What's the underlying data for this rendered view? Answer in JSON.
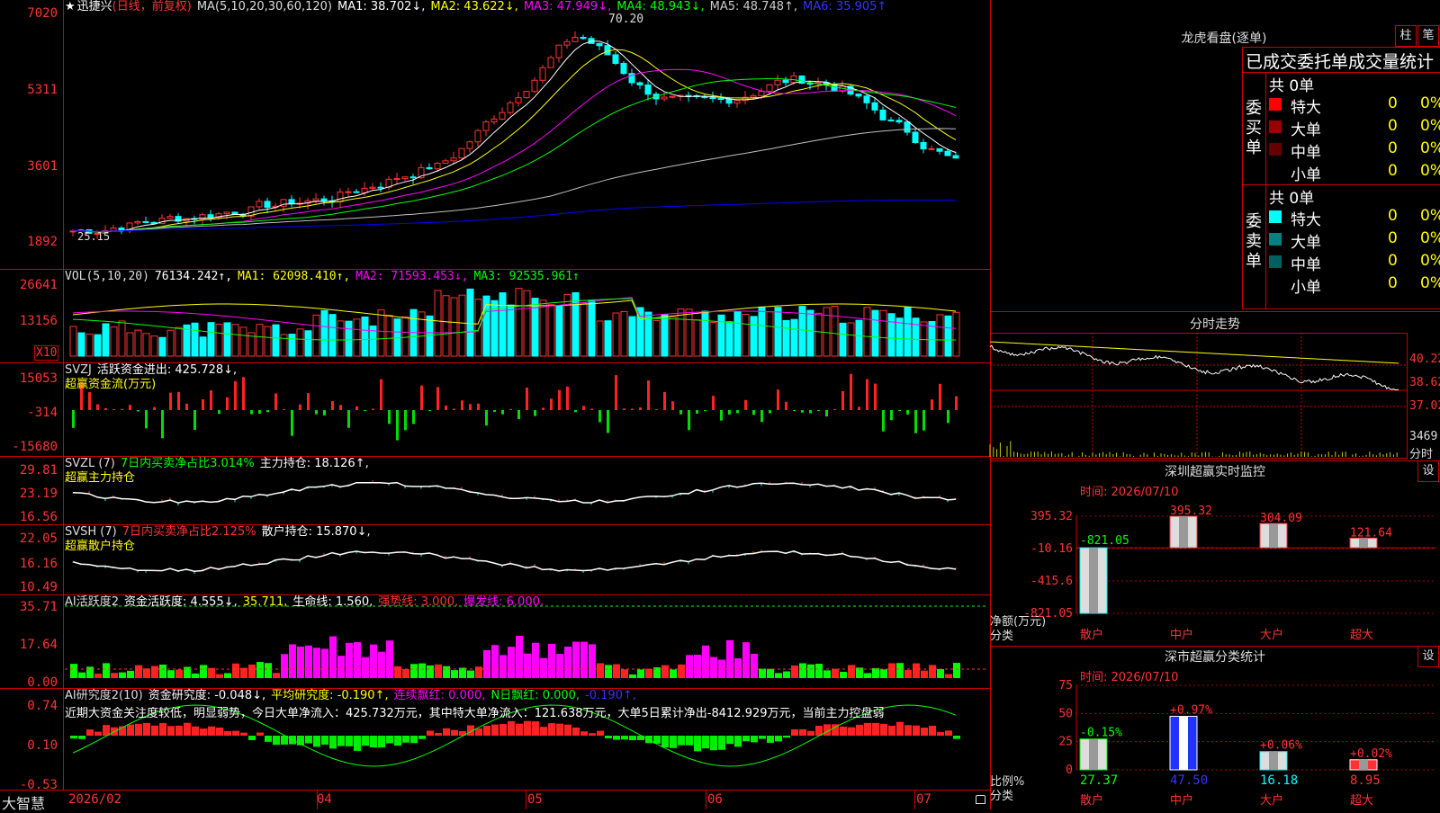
{
  "kline": {
    "title_star": "★",
    "stock": "迅捷兴",
    "mode": "(日线，前复权)",
    "ma_label": "MA(5,10,20,30,60,120)",
    "ma1": "MA1: 38.702↓,",
    "ma2": "MA2: 43.622↓,",
    "ma3": "MA3: 47.949↓,",
    "ma4": "MA4: 48.943↓,",
    "ma5": "MA5: 48.748↑,",
    "ma6": "MA6: 35.905↑",
    "peak_label": "70.20",
    "low_label": "25.15",
    "y_labels": [
      "7020",
      "5311",
      "3601",
      "1892"
    ],
    "colors": {
      "ma1": "#ffffff",
      "ma2": "#ffff00",
      "ma3": "#ff00ff",
      "ma4": "#00ff00",
      "ma5": "#c0c0c0",
      "ma6": "#0000ff"
    }
  },
  "vol": {
    "label": "VOL(5,10,20)",
    "value": "76134.242↑,",
    "ma1": "MA1: 62098.410↑,",
    "ma2": "MA2: 71593.453↓,",
    "ma3": "MA3: 92535.961↑",
    "y_labels": [
      "26641",
      "13156"
    ],
    "unit": "X10"
  },
  "svzj": {
    "label": "SVZJ",
    "name": "活跃资金进出: 425.728↓,",
    "sub": "超赢资金流(万元)",
    "y_labels": [
      "15053",
      "-314",
      "-15680"
    ]
  },
  "svzl": {
    "label": "SVZL (7)",
    "pct": "7日内买卖净占比3.014%",
    "hold": "主力持仓: 18.126↑,",
    "sub": "超赢主力持仓",
    "y_labels": [
      "29.81",
      "23.19",
      "16.56"
    ]
  },
  "svsh": {
    "label": "SVSH (7)",
    "pct": "7日内买卖净占比2.125%",
    "hold": "散户持仓: 15.870↓,",
    "sub": "超赢散户持仓",
    "y_labels": [
      "22.05",
      "16.16",
      "10.49"
    ]
  },
  "ai1": {
    "label": "AI活跃度2",
    "name": "资金活跃度: 4.555↓,",
    "v2": "35.711,",
    "life": "生命线: 1.560,",
    "strong": "强势线: 3.000,",
    "burst": "爆发线: 6.000,",
    "y_labels": [
      "35.71",
      "17.64",
      "0.00"
    ]
  },
  "ai2": {
    "label": "AI研究度2(10)",
    "name": "资金研究度: -0.048↓,",
    "avg": "平均研究度: -0.190↑,",
    "red": "连续飘红: 0.000,",
    "nred": "N日飘红: 0.000,",
    "last": "-0.190↑,",
    "comment": "近期大资金关注度较低，明显弱势，今日大单净流入：425.732万元，其中特大单净流入：121.638万元，大单5日累计净出-8412.929万元，当前主力控盘弱",
    "y_labels": [
      "0.74",
      "0.10",
      "-0.53"
    ]
  },
  "xaxis": {
    "brand": "大智慧",
    "labels": [
      "2026/02",
      "04",
      "05",
      "06",
      "07"
    ]
  },
  "dragon": {
    "title": "龙虎看盘(逐单)",
    "btn1": "柱",
    "btn2": "笔",
    "tabs": "已成交委托单成交量统计",
    "buy_label": "委买单",
    "sell_label": "委卖单",
    "buy_total": "共 0单",
    "sell_total": "共 0单",
    "buy_rows": [
      {
        "name": "特大",
        "count": "0",
        "pct": "0%",
        "color": "#ff0000"
      },
      {
        "name": "大单",
        "count": "0",
        "pct": "0%",
        "color": "#990000"
      },
      {
        "name": "中单",
        "count": "0",
        "pct": "0%",
        "color": "#660000"
      },
      {
        "name": "小单",
        "count": "0",
        "pct": "0%",
        "color": "#000000"
      }
    ],
    "sell_rows": [
      {
        "name": "特大",
        "count": "0",
        "pct": "0%",
        "color": "#00ffff"
      },
      {
        "name": "大单",
        "count": "0",
        "pct": "0%",
        "color": "#008080"
      },
      {
        "name": "中单",
        "count": "0",
        "pct": "0%",
        "color": "#006060"
      },
      {
        "name": "小单",
        "count": "0",
        "pct": "0%",
        "color": "#000000"
      }
    ]
  },
  "intraday": {
    "title": "分时走势",
    "y_labels": [
      "40.22",
      "38.62",
      "37.02",
      "3469"
    ],
    "sub": "分时"
  },
  "monitor": {
    "title": "深圳超赢实时监控",
    "btn": "设",
    "time": "时间: 2026/07/10",
    "y_labels": [
      "395.32",
      "-10.16",
      "-415.6",
      "-821.05"
    ],
    "ylabel": "净额(万元)",
    "xlabel": "分类",
    "bars": [
      {
        "cat": "散户",
        "value": -821.05,
        "label": "-821.05"
      },
      {
        "cat": "中户",
        "value": 395.32,
        "label": "395.32"
      },
      {
        "cat": "大户",
        "value": 304.09,
        "label": "304.09"
      },
      {
        "cat": "超大",
        "value": 121.64,
        "label": "121.64"
      }
    ]
  },
  "classify": {
    "title": "深市超赢分类统计",
    "btn": "设",
    "time": "时间: 2026/07/10",
    "y_labels": [
      "75",
      "50",
      "25",
      "0"
    ],
    "ylabel": "比例%",
    "xlabel": "分类",
    "bars": [
      {
        "cat": "散户",
        "value": 27.37,
        "label": "27.37",
        "change": "-0.15%"
      },
      {
        "cat": "中户",
        "value": 47.5,
        "label": "47.50",
        "change": "+0.97%"
      },
      {
        "cat": "大户",
        "value": 16.18,
        "label": "16.18",
        "change": "+0.06%"
      },
      {
        "cat": "超大",
        "value": 8.95,
        "label": "8.95",
        "change": "+0.02%"
      }
    ]
  }
}
